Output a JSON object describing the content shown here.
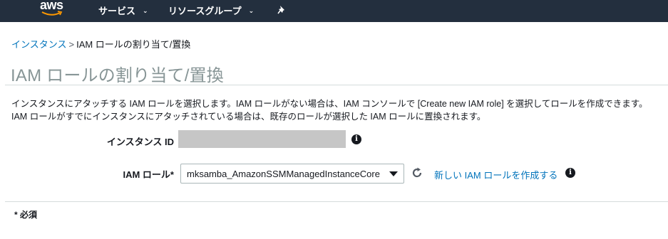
{
  "topnav": {
    "logo_text": "aws",
    "services_label": "サービス",
    "resource_groups_label": "リソースグループ",
    "caret": "⌄"
  },
  "breadcrumb": {
    "link": "インスタンス",
    "separator": ">",
    "current": "IAM ロールの割り当て/置換"
  },
  "page": {
    "title": "IAM ロールの割り当て/置換",
    "description_line1": "インスタンスにアタッチする IAM ロールを選択します。IAM ロールがない場合は、IAM コンソールで [Create new IAM role] を選択してロールを作成できます。",
    "description_line2": "IAM ロールがすでにインスタンスにアタッチされている場合は、既存のロールが選択した IAM ロールに置換されます。"
  },
  "form": {
    "instance_id_label": "インスタンス ID",
    "iam_role_label": "IAM ロール*",
    "iam_role_value": "mksamba_AmazonSSMManagedInstanceCore",
    "create_role_link": "新しい IAM ロールを作成する",
    "info_glyph": "i"
  },
  "footer": {
    "required_note": "* 必須"
  },
  "colors": {
    "nav_bg": "#232f3e",
    "link": "#0073bb",
    "logo_smile": "#ff9900",
    "title": "#879596"
  },
  "icons": {
    "nav": [
      "aws-logo",
      "chevron-down-icon",
      "pin-icon"
    ],
    "form": [
      "info-icon",
      "refresh-icon",
      "caret-down-icon"
    ]
  }
}
